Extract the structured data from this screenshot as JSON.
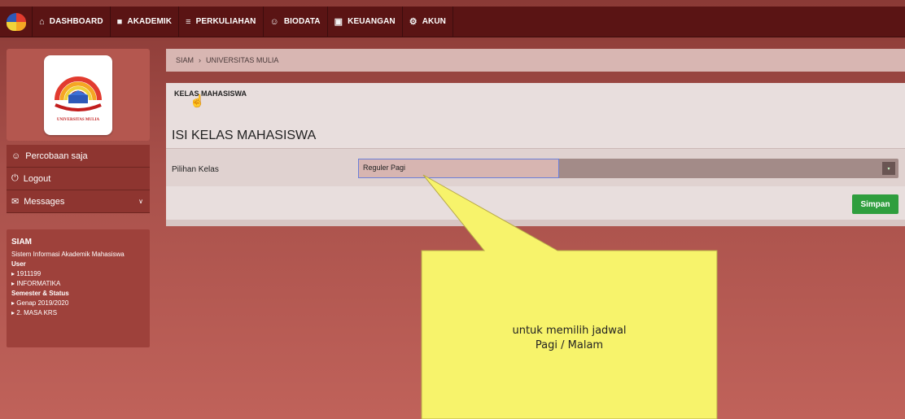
{
  "topbar": {
    "items": [
      {
        "label": "DASHBOARD",
        "icon": "home-icon",
        "glyph": "⌂"
      },
      {
        "label": "AKADEMIK",
        "icon": "briefcase-icon",
        "glyph": "■"
      },
      {
        "label": "PERKULIAHAN",
        "icon": "chart-icon",
        "glyph": "≡"
      },
      {
        "label": "BIODATA",
        "icon": "user-icon",
        "glyph": "☺"
      },
      {
        "label": "KEUANGAN",
        "icon": "money-icon",
        "glyph": "▣"
      },
      {
        "label": "AKUN",
        "icon": "cogs-icon",
        "glyph": "⚙"
      }
    ]
  },
  "sidebar": {
    "logo_text": "UNIVERSITAS MULIA",
    "menu": [
      {
        "label": "Percobaan saja",
        "icon": "user-icon",
        "glyph": "☺"
      },
      {
        "label": "Logout",
        "icon": "power-icon",
        "glyph": "⏻"
      },
      {
        "label": "Messages",
        "icon": "envelope-icon",
        "glyph": "✉"
      }
    ],
    "info": {
      "title": "SIAM",
      "subtitle": "Sistem Informasi Akademik Mahasiswa",
      "user_label": "User",
      "user_id": "▸ 1911199",
      "user_major": "▸ INFORMATIKA",
      "semester_label": "Semester & Status",
      "semester": "▸ Genap 2019/2020",
      "status": "▸ 2. MASA KRS"
    }
  },
  "breadcrumb": {
    "root": "SIAM",
    "separator": "›",
    "current": "UNIVERSITAS MULIA"
  },
  "panel": {
    "header": "KELAS MAHASISWA",
    "title": "ISI KELAS MAHASISWA",
    "field_label": "Pilihan Kelas",
    "select_value": "Reguler Pagi",
    "save_label": "Simpan"
  },
  "callout": {
    "line1": "untuk memilih jadwal",
    "line2": "Pagi / Malam"
  },
  "colors": {
    "navbar": "#5a1414",
    "save_button": "#2f9e3e",
    "callout": "#f7f36b"
  }
}
